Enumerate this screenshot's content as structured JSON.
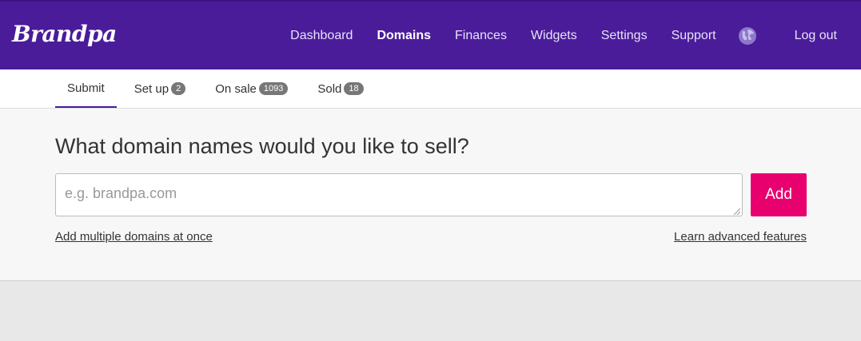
{
  "brand": {
    "name": "Brandpa",
    "color": "#4a1c9a",
    "accent": "#e8006e"
  },
  "nav": {
    "items": [
      {
        "label": "Dashboard",
        "active": false
      },
      {
        "label": "Domains",
        "active": true
      },
      {
        "label": "Finances",
        "active": false
      },
      {
        "label": "Widgets",
        "active": false
      },
      {
        "label": "Settings",
        "active": false
      },
      {
        "label": "Support",
        "active": false
      }
    ],
    "globe_icon": "globe-icon",
    "logout_label": "Log out"
  },
  "tabs": [
    {
      "label": "Submit",
      "count": null,
      "active": true
    },
    {
      "label": "Set up",
      "count": "2",
      "active": false
    },
    {
      "label": "On sale",
      "count": "1093",
      "active": false
    },
    {
      "label": "Sold",
      "count": "18",
      "active": false
    }
  ],
  "submit": {
    "heading": "What domain names would you like to sell?",
    "input_value": "",
    "input_placeholder": "e.g. brandpa.com",
    "add_label": "Add",
    "multiple_link": "Add multiple domains at once",
    "advanced_link": "Learn advanced features"
  }
}
